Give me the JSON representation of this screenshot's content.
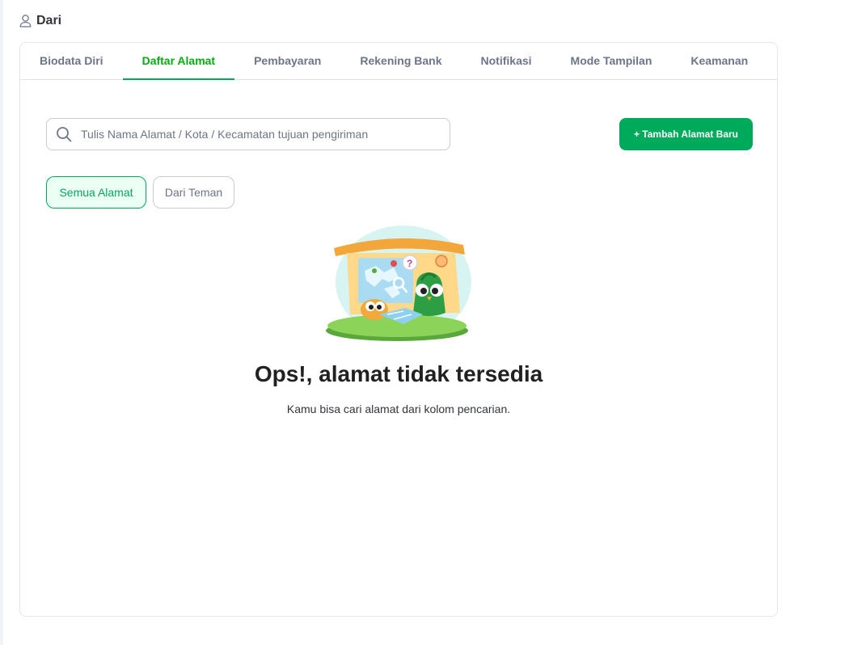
{
  "header": {
    "name": "Dari",
    "icon": "user-icon"
  },
  "tabs": [
    {
      "label": "Biodata Diri",
      "active": false
    },
    {
      "label": "Daftar Alamat",
      "active": true
    },
    {
      "label": "Pembayaran",
      "active": false
    },
    {
      "label": "Rekening Bank",
      "active": false
    },
    {
      "label": "Notifikasi",
      "active": false
    },
    {
      "label": "Mode Tampilan",
      "active": false
    },
    {
      "label": "Keamanan",
      "active": false
    }
  ],
  "search": {
    "placeholder": "Tulis Nama Alamat / Kota / Kecamatan tujuan pengiriman",
    "value": "",
    "icon": "search-icon"
  },
  "add_button": {
    "label": "+ Tambah Alamat Baru"
  },
  "filters": [
    {
      "label": "Semua Alamat",
      "active": true
    },
    {
      "label": "Dari Teman",
      "active": false
    }
  ],
  "empty_state": {
    "title": "Ops!, alamat tidak tersedia",
    "description": "Kamu bisa cari alamat dari kolom pencarian.",
    "illustration": "owl-map-illustration"
  },
  "colors": {
    "accent": "#00aa5b",
    "active_tab": "#03ac0e",
    "text": "#31353b"
  }
}
